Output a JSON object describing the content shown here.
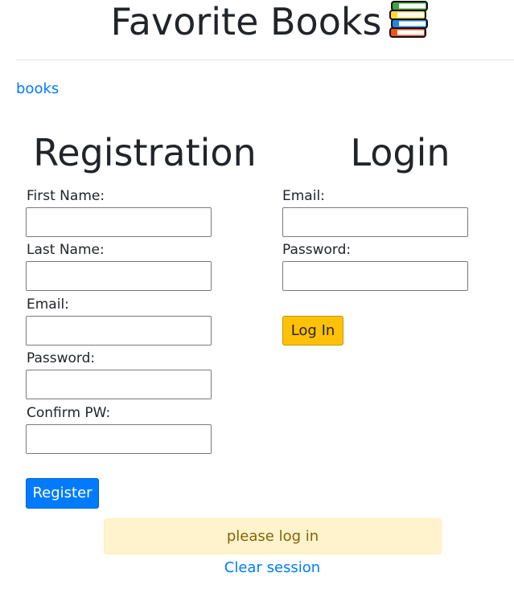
{
  "header": {
    "title": "Favorite Books",
    "icon": "books-icon"
  },
  "nav": {
    "books_link": "books"
  },
  "registration": {
    "heading": "Registration",
    "first_name_label": "First Name:",
    "first_name_value": "",
    "last_name_label": "Last Name:",
    "last_name_value": "",
    "email_label": "Email:",
    "email_value": "",
    "password_label": "Password:",
    "password_value": "",
    "confirm_label": "Confirm PW:",
    "confirm_value": "",
    "submit_label": "Register"
  },
  "login": {
    "heading": "Login",
    "email_label": "Email:",
    "email_value": "",
    "password_label": "Password:",
    "password_value": "",
    "submit_label": "Log In"
  },
  "alert": {
    "message": "please log in"
  },
  "footer": {
    "clear_session_link": "Clear session"
  },
  "colors": {
    "primary": "#007bff",
    "warning": "#ffc107",
    "alert_bg": "#fff3cd",
    "alert_text": "#856404",
    "text": "#212529"
  }
}
